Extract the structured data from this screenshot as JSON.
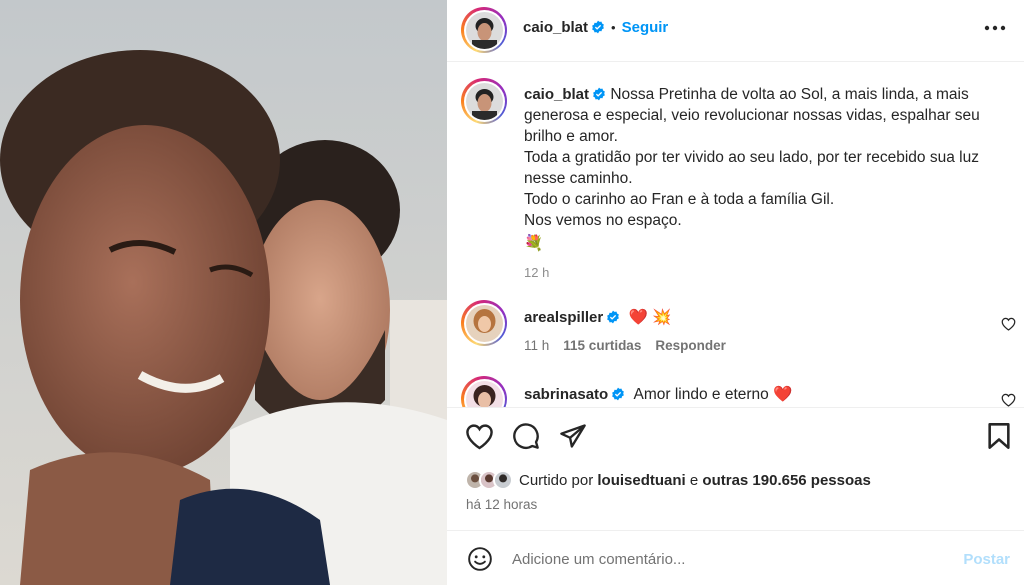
{
  "post": {
    "author": "caio_blat",
    "follow_label": "Seguir",
    "dot": "•",
    "caption_author": "caio_blat",
    "caption_lines": [
      "Nossa Pretinha de volta ao Sol, a mais linda, a mais generosa e especial, veio revolucionar nossas vidas, espalhar seu brilho e amor.",
      "Toda a gratidão por ter vivido ao seu lado, por ter recebido sua luz nesse caminho.",
      "Todo o carinho ao Fran e à toda a família Gil.",
      "Nos vemos no espaço."
    ],
    "caption_emoji": "💐",
    "caption_time": "12 h"
  },
  "comments": [
    {
      "user": "arealspiller",
      "text": "❤️ 💥",
      "time": "11 h",
      "likes": "115 curtidas",
      "reply": "Responder"
    },
    {
      "user": "sabrinasato",
      "text": "Amor lindo e eterno ❤️"
    }
  ],
  "likes": {
    "prefix": "Curtido por",
    "user": "louisedtuani",
    "joiner": "e",
    "others": "outras 190.656 pessoas"
  },
  "time_ago": "há 12 horas",
  "comment_input": {
    "placeholder": "Adicione um comentário...",
    "post_label": "Postar"
  },
  "icons": {
    "more": "more-horizontal-icon",
    "like": "heart-icon",
    "comment": "comment-icon",
    "share": "send-icon",
    "save": "bookmark-icon",
    "emoji": "emoji-icon",
    "verified": "verified-badge-icon"
  },
  "colors": {
    "link": "#0095f6",
    "verified": "#0095f6",
    "muted": "#737373",
    "post_disabled": "#b2dffc"
  }
}
